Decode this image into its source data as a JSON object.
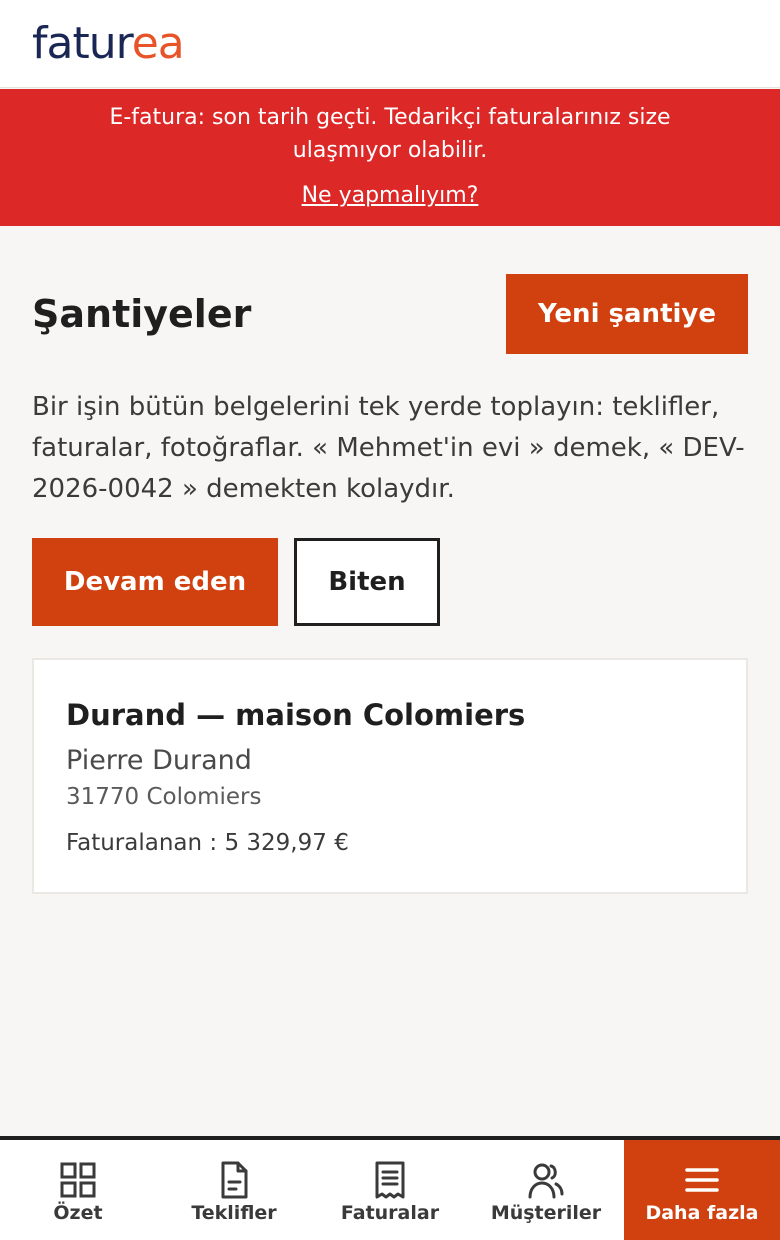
{
  "header": {
    "logo_part1": "fatur",
    "logo_part2": "ea"
  },
  "banner": {
    "message": "E-fatura: son tarih geçti. Tedarikçi faturalarınız size ulaşmıyor olabilir.",
    "link_label": "Ne yapmalıyım?"
  },
  "main": {
    "title": "Şantiyeler",
    "new_button_label": "Yeni şantiye",
    "description": "Bir işin bütün belgelerini tek yerde toplayın: teklifler, faturalar, fotoğraflar. « Mehmet'in evi » demek, « DEV-2026-0042 » demekten kolaydır.",
    "filters": [
      {
        "label": "Devam eden",
        "active": true
      },
      {
        "label": "Biten",
        "active": false
      }
    ],
    "sites": [
      {
        "title": "Durand — maison Colomiers",
        "client": "Pierre Durand",
        "address": "31770 Colomiers",
        "invoiced": "Faturalanan : 5 329,97 €"
      }
    ]
  },
  "bottom_nav": {
    "items": [
      {
        "label": "Özet",
        "icon": "grid-icon",
        "active": false
      },
      {
        "label": "Teklifler",
        "icon": "document-icon",
        "active": false
      },
      {
        "label": "Faturalar",
        "icon": "receipt-icon",
        "active": false
      },
      {
        "label": "Müşteriler",
        "icon": "users-icon",
        "active": false
      },
      {
        "label": "Daha fazla",
        "icon": "menu-icon",
        "active": true
      }
    ]
  },
  "colors": {
    "brand_navy": "#1a2755",
    "brand_orange": "#e8542a",
    "accent": "#d0410f",
    "banner_red": "#dd2828"
  }
}
